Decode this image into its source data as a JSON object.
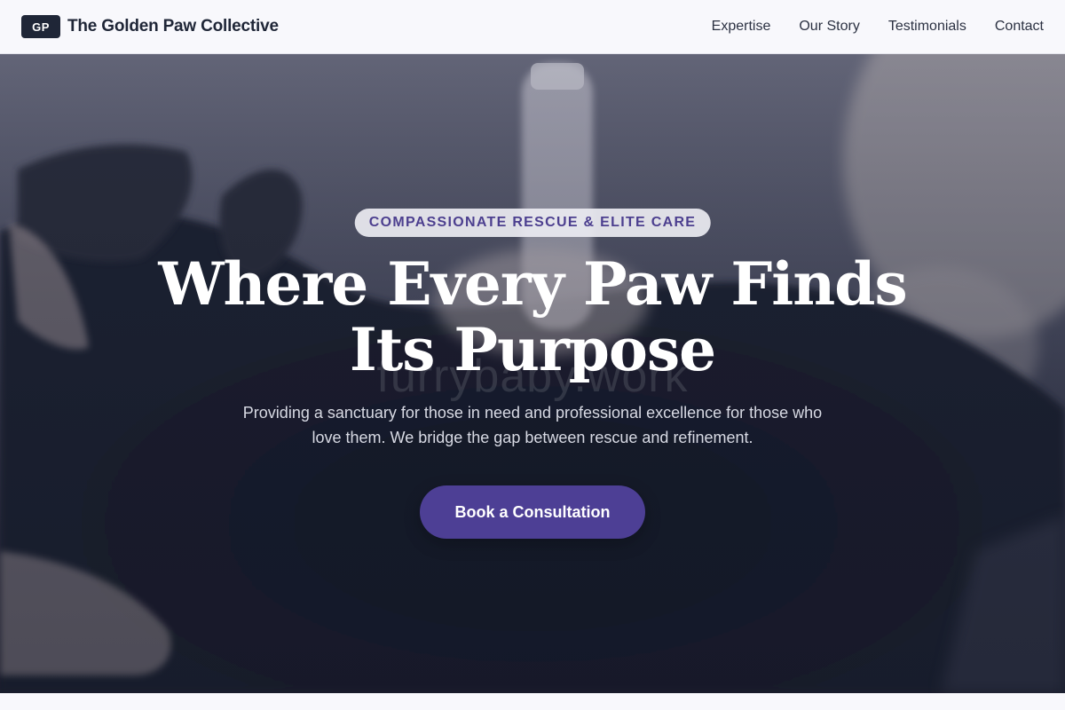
{
  "header": {
    "logo_initials": "GP",
    "brand_name": "The Golden Paw Collective",
    "nav": [
      {
        "label": "Expertise"
      },
      {
        "label": "Our Story"
      },
      {
        "label": "Testimonials"
      },
      {
        "label": "Contact"
      }
    ]
  },
  "hero": {
    "eyebrow": "COMPASSIONATE RESCUE & ELITE CARE",
    "title_line1": "Where Every Paw Finds",
    "title_line2": "Its Purpose",
    "watermark": "furrybaby.work",
    "subtitle": "Providing a sanctuary for those in need and professional excellence for those who love them. We bridge the gap between rescue and refinement.",
    "cta_label": "Book a Consultation",
    "background_image": "dog-grooming-photo"
  },
  "colors": {
    "accent": "#4d3f95",
    "eyebrow_text": "#4c3f8f",
    "header_bg": "#f8f8fc",
    "logo_bg": "#1f2637"
  }
}
